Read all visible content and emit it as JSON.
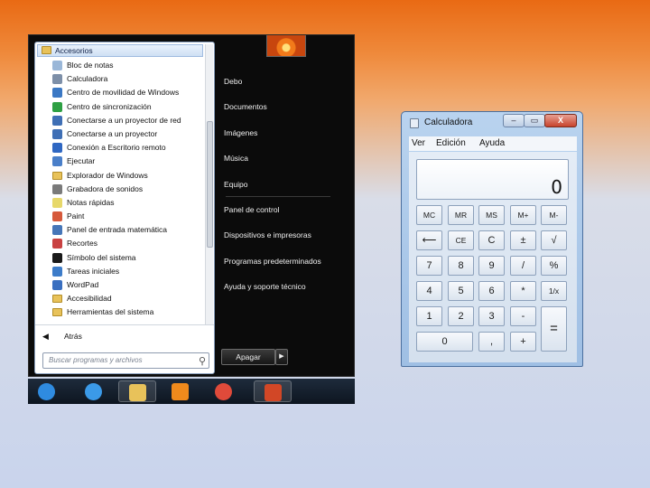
{
  "start_menu": {
    "folder_header": "Accesorios",
    "items": [
      {
        "label": "Bloc de notas",
        "icon": "notepad-icon",
        "color": "#9ab7d8"
      },
      {
        "label": "Calculadora",
        "icon": "calculator-icon",
        "color": "#7d8fa8"
      },
      {
        "label": "Centro de movilidad de Windows",
        "icon": "mobility-center-icon",
        "color": "#3b78c4"
      },
      {
        "label": "Centro de sincronización",
        "icon": "sync-center-icon",
        "color": "#2ea043"
      },
      {
        "label": "Conectarse a un proyector de red",
        "icon": "network-projector-icon",
        "color": "#3f6fb5"
      },
      {
        "label": "Conectarse a un proyector",
        "icon": "projector-icon",
        "color": "#3f6fb5"
      },
      {
        "label": "Conexión a Escritorio remoto",
        "icon": "remote-desktop-icon",
        "color": "#2f67c2"
      },
      {
        "label": "Ejecutar",
        "icon": "run-icon",
        "color": "#4a7fc9"
      },
      {
        "label": "Explorador de Windows",
        "icon": "folder-icon",
        "color": "#e8c25a"
      },
      {
        "label": "Grabadora de sonidos",
        "icon": "microphone-icon",
        "color": "#7a7a7a"
      },
      {
        "label": "Notas rápidas",
        "icon": "sticky-note-icon",
        "color": "#e7d86a"
      },
      {
        "label": "Paint",
        "icon": "paint-icon",
        "color": "#d6593b"
      },
      {
        "label": "Panel de entrada matemática",
        "icon": "math-input-icon",
        "color": "#4676b8"
      },
      {
        "label": "Recortes",
        "icon": "scissors-icon",
        "color": "#c94141"
      },
      {
        "label": "Símbolo del sistema",
        "icon": "command-prompt-icon",
        "color": "#1a1a1a"
      },
      {
        "label": "Tareas iniciales",
        "icon": "getting-started-icon",
        "color": "#3d7cc9"
      },
      {
        "label": "WordPad",
        "icon": "wordpad-icon",
        "color": "#3a6fc0"
      },
      {
        "label": "Accesibilidad",
        "icon": "folder-icon",
        "color": "#e8c25a"
      },
      {
        "label": "Herramientas del sistema",
        "icon": "folder-icon",
        "color": "#e8c25a"
      }
    ],
    "back_label": "Atrás",
    "search_placeholder": "Buscar programas y archivos",
    "right_items": [
      "Debo",
      "Documentos",
      "Imágenes",
      "Música",
      "Equipo",
      "Panel de control",
      "Dispositivos e impresoras",
      "Programas predeterminados",
      "Ayuda y soporte técnico"
    ],
    "shutdown_label": "Apagar"
  },
  "taskbar": {
    "items": [
      {
        "icon": "start-orb-icon",
        "color": "#2f8be0"
      },
      {
        "icon": "internet-explorer-icon",
        "color": "#3b9ae8"
      },
      {
        "icon": "windows-explorer-icon",
        "color": "#e8c25a"
      },
      {
        "icon": "media-player-icon",
        "color": "#f08a1c"
      },
      {
        "icon": "chrome-icon",
        "color": "#e04a3a"
      },
      {
        "icon": "powerpoint-icon",
        "color": "#d24726"
      }
    ]
  },
  "calculator": {
    "title": "Calculadora",
    "close_label": "X",
    "menu": [
      "Ver",
      "Edición",
      "Ayuda"
    ],
    "display": "0",
    "keys": [
      [
        "MC",
        "MR",
        "MS",
        "M+",
        "M-"
      ],
      [
        "⟵",
        "CE",
        "C",
        "±",
        "√"
      ],
      [
        "7",
        "8",
        "9",
        "/",
        "%"
      ],
      [
        "4",
        "5",
        "6",
        "*",
        "1/x"
      ],
      [
        "1",
        "2",
        "3",
        "-",
        "="
      ],
      [
        "0",
        ",",
        "+"
      ]
    ]
  }
}
